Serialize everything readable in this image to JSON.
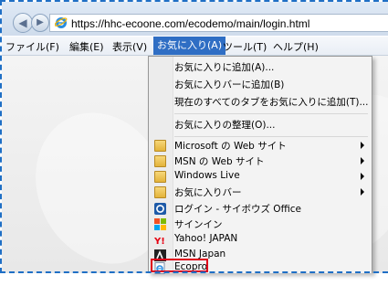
{
  "browser": {
    "url": "https://hhc-ecoone.com/ecodemo/main/login.html"
  },
  "menubar": {
    "items": [
      {
        "label": "ファイル(F)"
      },
      {
        "label": "編集(E)"
      },
      {
        "label": "表示(V)"
      },
      {
        "label": "お気に入り(A)"
      },
      {
        "label": "ツール(T)"
      },
      {
        "label": "ヘルプ(H)"
      }
    ]
  },
  "favorites_menu": {
    "actions": [
      {
        "label": "お気に入りに追加(A)..."
      },
      {
        "label": "お気に入りバーに追加(B)"
      },
      {
        "label": "現在のすべてのタブをお気に入りに追加(T)..."
      }
    ],
    "organize": {
      "label": "お気に入りの整理(O)..."
    },
    "folders": [
      {
        "label": "Microsoft の Web サイト",
        "icon": "folder-icon"
      },
      {
        "label": "MSN の Web サイト",
        "icon": "folder-icon"
      },
      {
        "label": "Windows Live",
        "icon": "folder-icon"
      },
      {
        "label": "お気に入りバー",
        "icon": "folder-icon"
      }
    ],
    "links": [
      {
        "label": "ログイン - サイボウズ Office",
        "icon": "cybozu-icon"
      },
      {
        "label": "サインイン",
        "icon": "windows-logo-icon"
      },
      {
        "label": "Yahoo! JAPAN",
        "icon": "yahoo-icon"
      },
      {
        "label": "MSN Japan",
        "icon": "msn-icon"
      },
      {
        "label": "Ecopro",
        "icon": "ie-page-icon"
      }
    ]
  },
  "colors": {
    "menu_active": "#2f6ec4",
    "highlight_border": "#e0001a",
    "frame_dashes": "#1f6fc5"
  }
}
